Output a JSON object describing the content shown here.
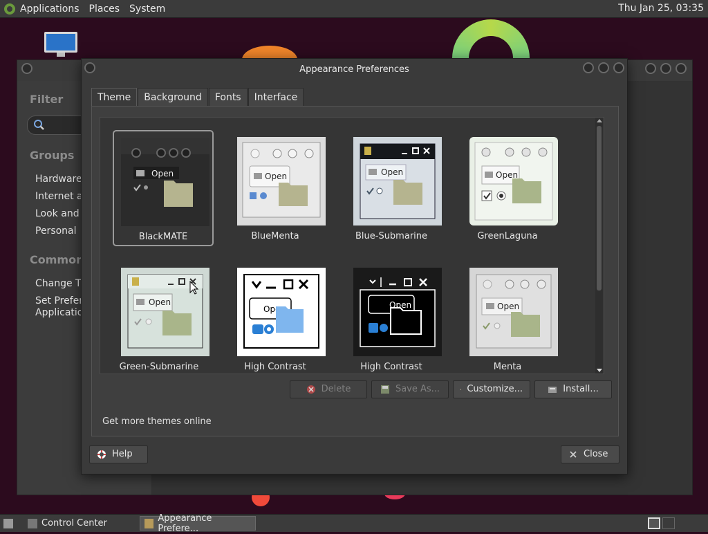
{
  "top_panel": {
    "menus": [
      "Applications",
      "Places",
      "System"
    ],
    "clock": "Thu Jan 25, 03:35"
  },
  "control_center": {
    "filter_heading": "Filter",
    "groups_heading": "Groups",
    "groups": [
      "Hardware",
      "Internet an",
      "Look and F",
      "Personal"
    ],
    "common_heading": "Common T",
    "common_tasks": [
      "Change Th",
      "Set Preferre",
      "Application"
    ]
  },
  "dialog": {
    "title": "Appearance Preferences",
    "tabs": [
      "Theme",
      "Background",
      "Fonts",
      "Interface"
    ],
    "themes": [
      "BlackMATE",
      "BlueMenta",
      "Blue-Submarine",
      "GreenLaguna",
      "Green-Submarine",
      "High Contrast",
      "High Contrast",
      "Menta"
    ],
    "thumb_text": "Open",
    "buttons": {
      "delete": "Delete",
      "save_as": "Save As...",
      "customize": "Customize...",
      "install": "Install..."
    },
    "get_more": "Get more themes online",
    "help": "Help",
    "close": "Close"
  },
  "taskbar": {
    "tasks": [
      "Control Center",
      "Appearance Prefere..."
    ]
  },
  "colors": {
    "panel": "#3b3b3b",
    "window": "#3a3a3a",
    "folder": "#b5b48f",
    "accent_blue": "#2a7fd4"
  }
}
